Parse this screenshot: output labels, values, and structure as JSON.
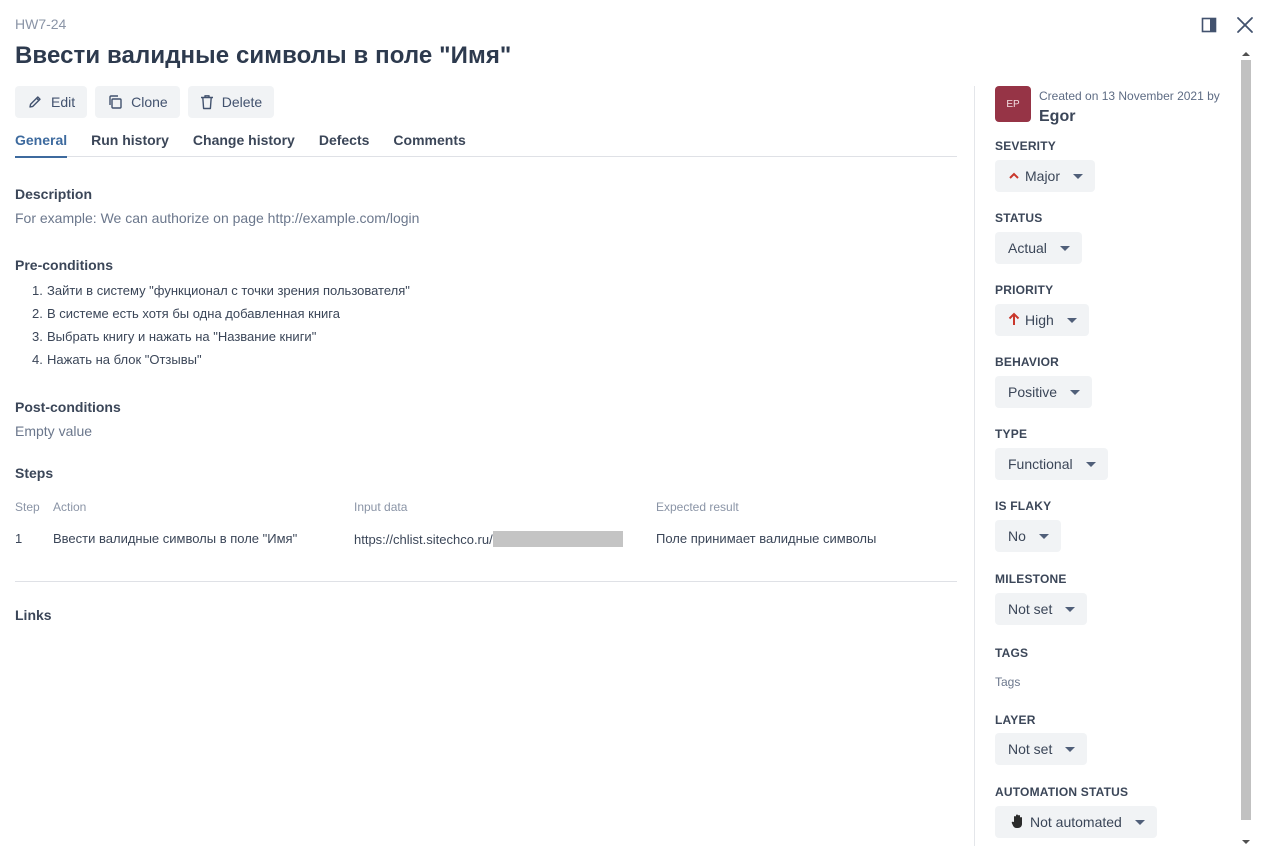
{
  "header": {
    "case_id": "HW7-24",
    "title": "Ввести валидные символы в поле \"Имя\""
  },
  "toolbar": {
    "edit_label": "Edit",
    "clone_label": "Clone",
    "delete_label": "Delete"
  },
  "tabs": [
    {
      "label": "General",
      "active": true
    },
    {
      "label": "Run history",
      "active": false
    },
    {
      "label": "Change history",
      "active": false
    },
    {
      "label": "Defects",
      "active": false
    },
    {
      "label": "Comments",
      "active": false
    }
  ],
  "description": {
    "label": "Description",
    "value": "For example: We can authorize on page http://example.com/login"
  },
  "preconditions": {
    "label": "Pre-conditions",
    "items": [
      "Зайти в систему \"функционал с точки зрения пользователя\"",
      "В системе есть хотя бы одна добавленная книга",
      "Выбрать книгу и нажать на \"Название книги\"",
      "Нажать на блок \"Отзывы\""
    ]
  },
  "postconditions": {
    "label": "Post-conditions",
    "value": "Empty value"
  },
  "steps": {
    "label": "Steps",
    "columns": [
      "Step",
      "Action",
      "Input data",
      "Expected result"
    ],
    "rows": [
      {
        "step": "1",
        "action": "Ввести валидные символы в поле \"Имя\"",
        "input": "https://chlist.sitechco.ru/",
        "expected": "Поле принимает валидные символы"
      }
    ]
  },
  "links": {
    "label": "Links"
  },
  "sidebar": {
    "avatar_initials": "EP",
    "created_text": "Created on 13 November 2021 by",
    "author": "Egor",
    "fields": {
      "severity": {
        "label": "SEVERITY",
        "value": "Major",
        "icon": "chevron-up-icon",
        "icon_color": "#c9372c"
      },
      "status": {
        "label": "STATUS",
        "value": "Actual"
      },
      "priority": {
        "label": "PRIORITY",
        "value": "High",
        "icon": "arrow-up-icon",
        "icon_color": "#c9372c"
      },
      "behavior": {
        "label": "BEHAVIOR",
        "value": "Positive"
      },
      "type": {
        "label": "TYPE",
        "value": "Functional"
      },
      "is_flaky": {
        "label": "IS FLAKY",
        "value": "No"
      },
      "milestone": {
        "label": "MILESTONE",
        "value": "Not set"
      },
      "tags": {
        "label": "TAGS",
        "value": "Tags"
      },
      "layer": {
        "label": "LAYER",
        "value": "Not set"
      },
      "automation_status": {
        "label": "AUTOMATION STATUS",
        "value": "Not automated",
        "icon": "hand-icon"
      }
    }
  }
}
